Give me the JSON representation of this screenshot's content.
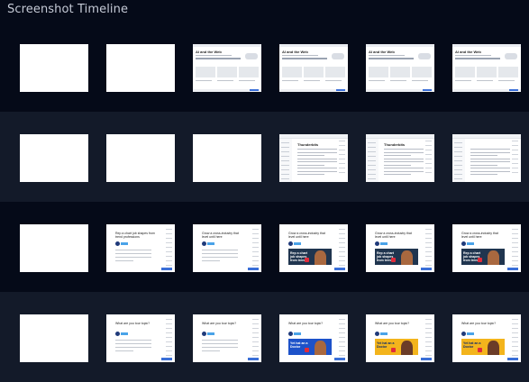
{
  "title": "Screenshot Timeline",
  "rows": [
    {
      "thumbs": [
        {
          "kind": "blank"
        },
        {
          "kind": "blank"
        },
        {
          "kind": "ai",
          "heading": "AI and the Web"
        },
        {
          "kind": "ai",
          "heading": "AI and the Web"
        },
        {
          "kind": "ai",
          "heading": "AI and the Web"
        },
        {
          "kind": "ai",
          "heading": "AI and the Web"
        }
      ]
    },
    {
      "thumbs": [
        {
          "kind": "blank"
        },
        {
          "kind": "blank"
        },
        {
          "kind": "blank"
        },
        {
          "kind": "doc",
          "heading": "Thunderbits"
        },
        {
          "kind": "doc",
          "heading": "Thunderbits"
        },
        {
          "kind": "doc",
          "heading": ""
        }
      ]
    },
    {
      "thumbs": [
        {
          "kind": "blank"
        },
        {
          "kind": "job",
          "heading": "Rep a chart job shapes from trend professions"
        },
        {
          "kind": "job",
          "heading": "Grow a cross-industry that level until here"
        },
        {
          "kind": "job",
          "heading": "Grow a cross-industry that level until here",
          "banner": "Rep a chart job shapes from trend"
        },
        {
          "kind": "job",
          "heading": "Grow a cross-industry that level until here",
          "banner": "Rep a chart job shapes from trend"
        },
        {
          "kind": "job",
          "heading": "Grow a cross-industry that level until here",
          "banner": "Rep a chart job shapes from trend"
        }
      ]
    },
    {
      "thumbs": [
        {
          "kind": "blank"
        },
        {
          "kind": "job",
          "heading": "What are you tour topic?"
        },
        {
          "kind": "job",
          "heading": "What are you tour topic?"
        },
        {
          "kind": "job",
          "heading": "What are you tour topic?",
          "banner": "Yet hat an a Doctor"
        },
        {
          "kind": "job",
          "heading": "What are you tour topic?",
          "banner": "Yet hat an a Doctor"
        },
        {
          "kind": "job",
          "heading": "What are you tour topic?",
          "banner": "Yet hat an a Doctor"
        }
      ]
    }
  ],
  "colors": {
    "background": "#050a18",
    "row_alt": "#131a29",
    "title": "#c5cad6",
    "thumb_bg": "#ffffff",
    "accent_blue": "#3a6fd8",
    "banner_yellow": "#f3b41c"
  }
}
